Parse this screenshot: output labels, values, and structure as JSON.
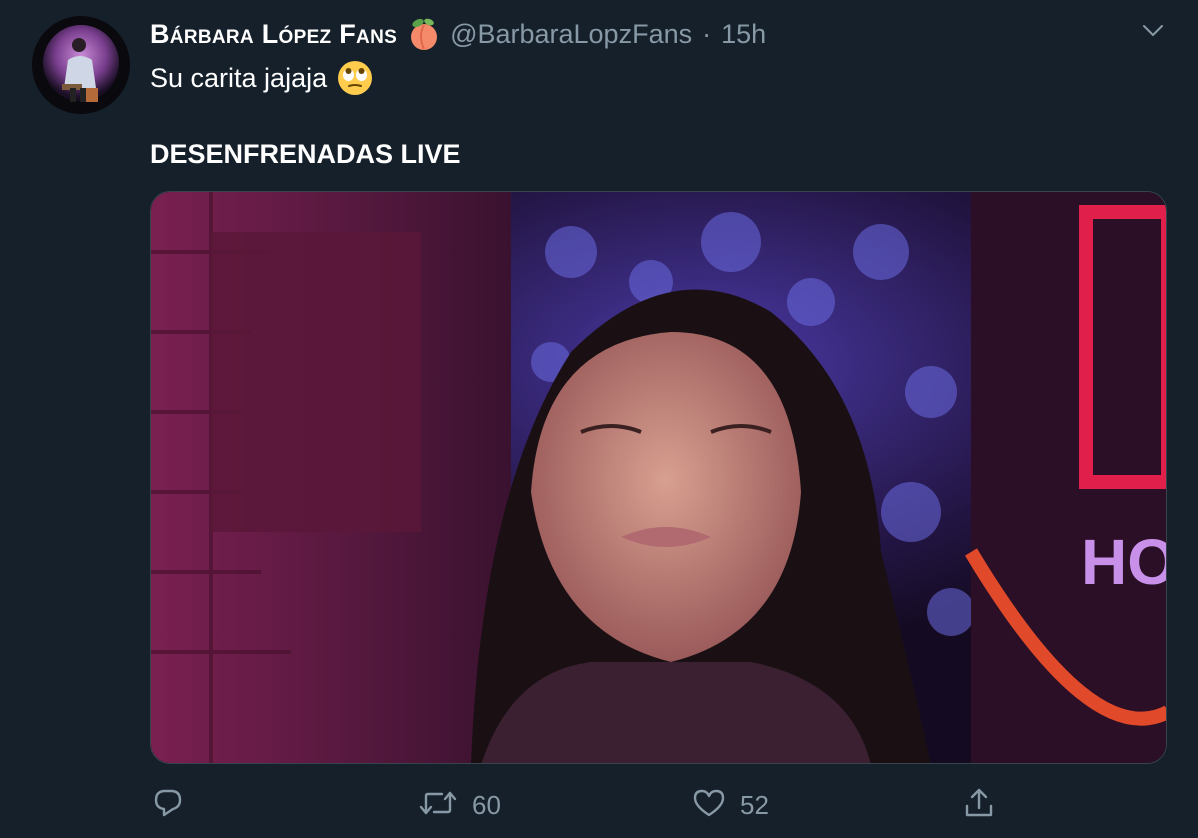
{
  "tweet": {
    "display_name": "Bárbara López Fans",
    "name_emoji": "peach-emoji",
    "handle": "@BarbaraLopzFans",
    "separator": "·",
    "time": "15h",
    "text_line1": "Su carita jajaja",
    "text_emoji": "face-with-rolling-eyes-emoji",
    "text_line2": "DESENFRENADAS LIVE"
  },
  "media": {
    "description_icon": "video-still-image",
    "overlay_text": "HO"
  },
  "actions": {
    "reply_count": "",
    "retweet_count": "60",
    "like_count": "52"
  },
  "colors": {
    "background": "#15202b",
    "secondary_text": "#8899a6",
    "border": "#38444d"
  }
}
